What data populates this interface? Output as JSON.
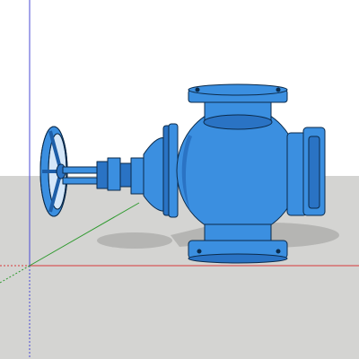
{
  "viewport": {
    "sky_color": "#ffffff",
    "ground_color": "#d4d4d2",
    "model_color": "#3b8fe0",
    "model_shade_color": "#2a73c4",
    "model_dark_color": "#1d5ea8",
    "edge_color": "#0b2a4a",
    "shadow_color": "#b5b5b3",
    "axis_red": "#d93a3a",
    "axis_green": "#2f9a2f",
    "axis_blue": "#4a4ad6"
  },
  "model": {
    "type": "angle-globe-valve-with-handwheel"
  }
}
